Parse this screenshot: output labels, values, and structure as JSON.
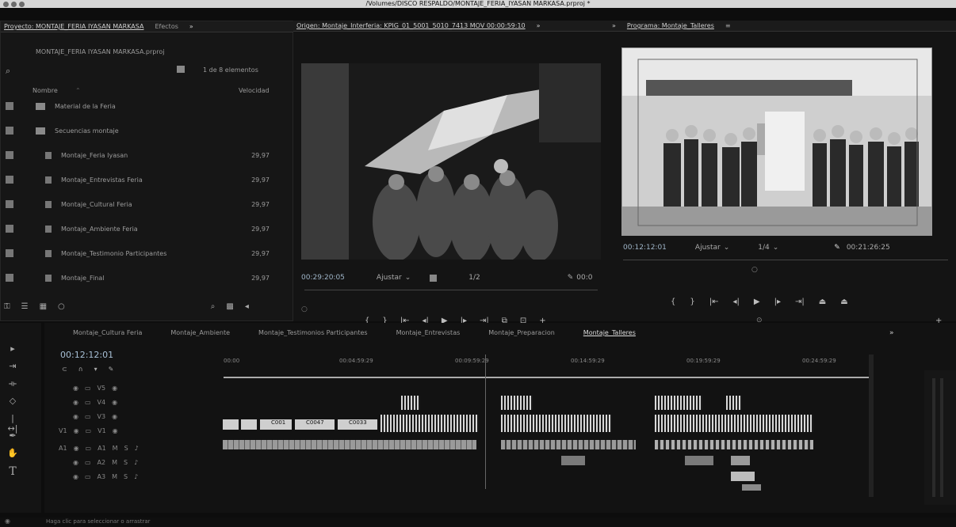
{
  "window": {
    "title": "/Volumes/DISCO RESPALDO/MONTAJE_FERIA_IYASAN MARKASA.prproj *"
  },
  "project_panel": {
    "tab_label": "Proyecto: MONTAJE_FERIA IYASAN MARKASA",
    "effects_tab": "Efectos",
    "file_name": "MONTAJE_FERIA IYASAN MARKASA.prproj",
    "items_selected": "1 de 8 elementos",
    "col_name": "Nombre",
    "col_rate": "Velocidad",
    "items": [
      {
        "name": "Material de la Feria",
        "rate": "",
        "type": "bin"
      },
      {
        "name": "Secuencias montaje",
        "rate": "",
        "type": "bin"
      },
      {
        "name": "Montaje_Feria Iyasan",
        "rate": "29,97",
        "type": "seq"
      },
      {
        "name": "Montaje_Entrevistas Feria",
        "rate": "29,97",
        "type": "seq"
      },
      {
        "name": "Montaje_Cultural Feria",
        "rate": "29,97",
        "type": "seq"
      },
      {
        "name": "Montaje_Ambiente Feria",
        "rate": "29,97",
        "type": "seq"
      },
      {
        "name": "Montaje_Testimonio Participantes",
        "rate": "29,97",
        "type": "seq"
      },
      {
        "name": "Montaje_Final",
        "rate": "29,97",
        "type": "seq"
      }
    ]
  },
  "source_monitor": {
    "tab_label": "Origen: Montaje_Interferia: KPIG_01_5001_5010_7413 MOV 00:00:59:10",
    "timecode": "00:29:20:05",
    "fit": "Ajustar",
    "quality": "1/2",
    "duration": "00:0"
  },
  "program_monitor": {
    "tab_label": "Programa: Montaje_Talleres",
    "timecode": "00:12:12:01",
    "fit": "Ajustar",
    "quality": "1/4",
    "duration": "00:21:26:25"
  },
  "timeline": {
    "tabs": [
      "Montaje_Cultura Feria",
      "Montaje_Ambiente",
      "Montaje_Testimonios Participantes",
      "Montaje_Entrevistas",
      "Montaje_Preparacion",
      "Montaje_Talleres"
    ],
    "timecode": "00:12:12:01",
    "ruler": [
      "00:00",
      "00:04:59:29",
      "00:09:59:29",
      "00:14:59:29",
      "00:19:59:29",
      "00:24:59:29"
    ],
    "clip_labels": [
      "C001",
      "C0047",
      "C0033"
    ]
  },
  "status": {
    "text": "Haga clic para seleccionar o arrastrar"
  },
  "icons": {
    "selection": "selection-arrow-icon",
    "track_select": "track-select-icon",
    "ripple": "ripple-edit-icon",
    "razor": "razor-icon",
    "slip": "slip-icon",
    "pen": "pen-icon",
    "hand": "hand-icon",
    "type": "type-tool-icon"
  }
}
